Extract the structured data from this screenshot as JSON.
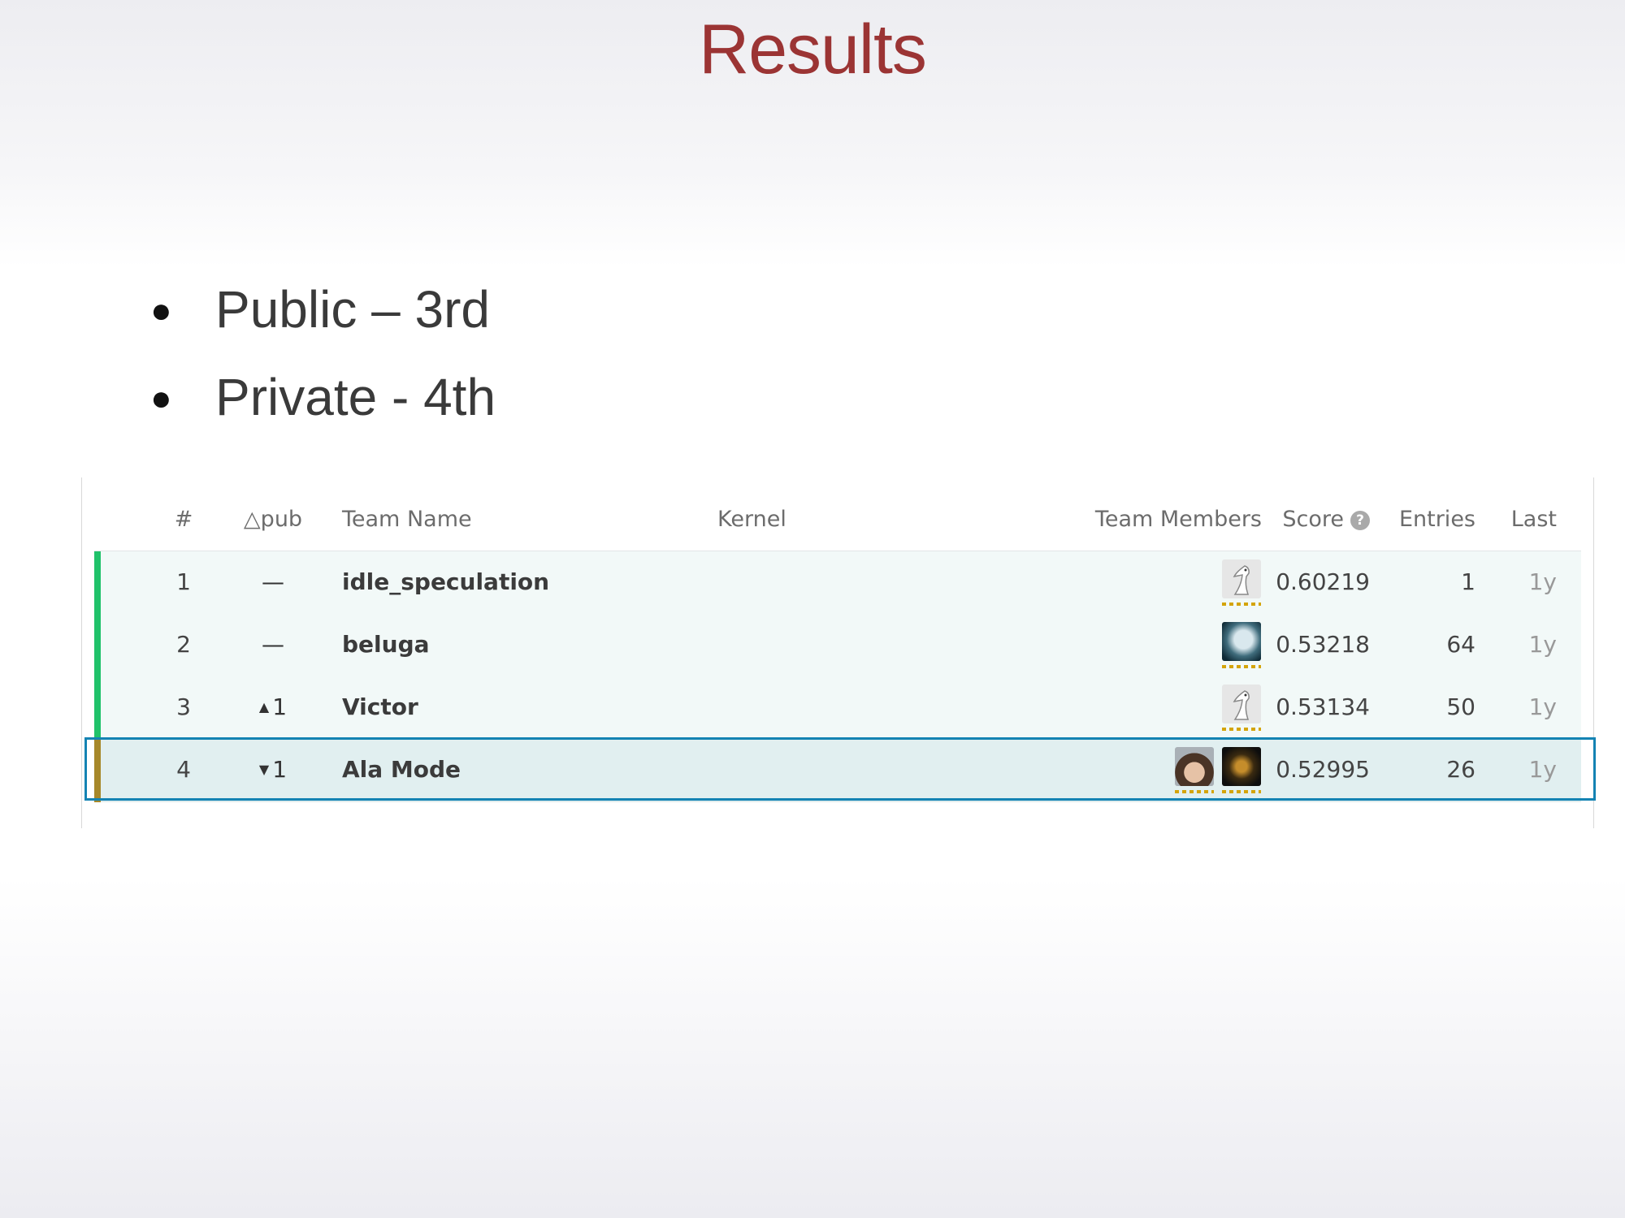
{
  "slide": {
    "title": "Results",
    "bullets": [
      "Public – 3rd",
      "Private - 4th"
    ]
  },
  "leaderboard": {
    "headers": {
      "rank": "#",
      "delta": "△pub",
      "team_name": "Team Name",
      "kernel": "Kernel",
      "team_members": "Team Members",
      "score": "Score",
      "entries": "Entries",
      "last": "Last"
    },
    "rows": [
      {
        "rank": "1",
        "delta": "—",
        "delta_dir": "none",
        "team": "idle_speculation",
        "members": [
          "goose-avatar"
        ],
        "score": "0.60219",
        "entries": "1",
        "last": "1y",
        "bar_color": "#20c26a"
      },
      {
        "rank": "2",
        "delta": "—",
        "delta_dir": "none",
        "team": "beluga",
        "members": [
          "beluga-avatar"
        ],
        "score": "0.53218",
        "entries": "64",
        "last": "1y",
        "bar_color": "#20c26a"
      },
      {
        "rank": "3",
        "delta": "1",
        "delta_dir": "up",
        "team": "Victor",
        "members": [
          "goose-avatar"
        ],
        "score": "0.53134",
        "entries": "50",
        "last": "1y",
        "bar_color": "#20c26a"
      },
      {
        "rank": "4",
        "delta": "1",
        "delta_dir": "down",
        "team": "Ala Mode",
        "members": [
          "person-avatar",
          "dark-avatar"
        ],
        "score": "0.52995",
        "entries": "26",
        "last": "1y",
        "bar_color": "#a6882a",
        "highlighted": true
      }
    ],
    "colors": {
      "title": "#9b3434",
      "highlight_border": "#1483b3",
      "up": "#4c9a2a",
      "down": "#c24242"
    }
  }
}
